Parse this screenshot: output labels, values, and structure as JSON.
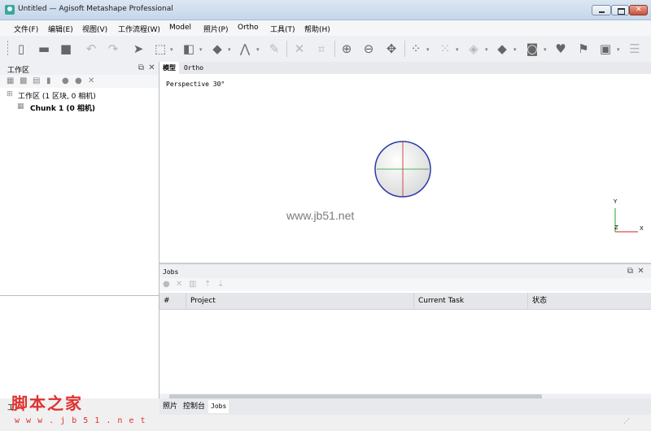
{
  "window": {
    "title": "Untitled — Agisoft Metashape Professional"
  },
  "menu": [
    "文件(F)",
    "编辑(E)",
    "视图(V)",
    "工作流程(W)",
    "Model",
    "照片(P)",
    "Ortho",
    "工具(T)",
    "帮助(H)"
  ],
  "workspace": {
    "title": "工作区",
    "tree_root": "工作区 (1 区块, 0 相机)",
    "chunk": "Chunk 1 (0 相机)",
    "bottom_label": "工"
  },
  "view_tabs": [
    "模型",
    "Ortho"
  ],
  "viewport": {
    "projection_label": "Perspective 30°",
    "watermark": "www.jb51.net",
    "axis_y": "Y",
    "axis_x": "X",
    "axis_z": "Z"
  },
  "jobs": {
    "title": "Jobs",
    "columns": [
      "#",
      "Project",
      "Current Task",
      "状态"
    ]
  },
  "bottom_tabs": [
    "照片",
    "控制台",
    "Jobs"
  ],
  "overlay_watermark": {
    "text": "脚本之家",
    "url": "w w w . j b 5 1 . n e t"
  },
  "colors": {
    "x_axis": "#cc2020",
    "y_axis": "#20a020",
    "z_axis": "#2030c0",
    "sphere_ring": "#2a3aa8"
  }
}
